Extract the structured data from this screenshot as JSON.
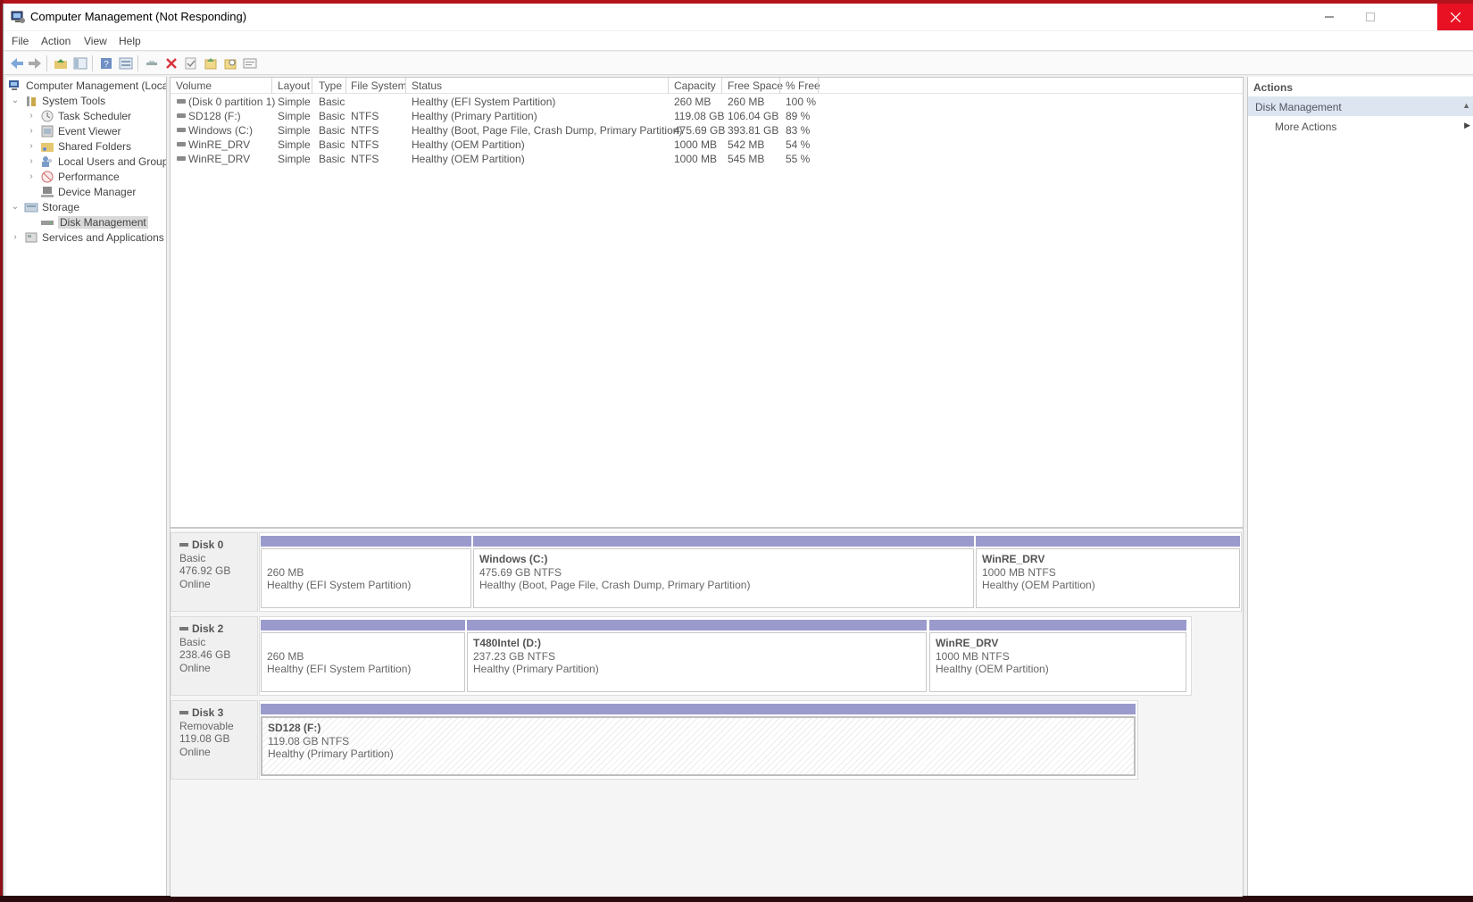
{
  "window": {
    "title": "Computer Management (Not Responding)"
  },
  "menu": [
    "File",
    "Action",
    "View",
    "Help"
  ],
  "toolbar": [
    "back-arrow-icon",
    "forward-arrow-icon",
    "up-folder-icon",
    "show-hide-tree-icon",
    "help-icon",
    "properties-icon",
    "connect-icon",
    "delete-icon",
    "check-icon",
    "export-icon",
    "search-icon",
    "list-icon"
  ],
  "tree": {
    "root": "Computer Management (Local",
    "system_tools": "System Tools",
    "task_scheduler": "Task Scheduler",
    "event_viewer": "Event Viewer",
    "shared_folders": "Shared Folders",
    "local_users": "Local Users and Groups",
    "performance": "Performance",
    "device_manager": "Device Manager",
    "storage": "Storage",
    "disk_management": "Disk Management",
    "services": "Services and Applications"
  },
  "volumes": {
    "headers": [
      "Volume",
      "Layout",
      "Type",
      "File System",
      "Status",
      "Capacity",
      "Free Space",
      "% Free"
    ],
    "rows": [
      [
        "(Disk 0 partition 1)",
        "Simple",
        "Basic",
        "",
        "Healthy (EFI System Partition)",
        "260 MB",
        "260 MB",
        "100 %"
      ],
      [
        "SD128 (F:)",
        "Simple",
        "Basic",
        "NTFS",
        "Healthy (Primary Partition)",
        "119.08 GB",
        "106.04 GB",
        "89 %"
      ],
      [
        "Windows (C:)",
        "Simple",
        "Basic",
        "NTFS",
        "Healthy (Boot, Page File, Crash Dump, Primary Partition)",
        "475.69 GB",
        "393.81 GB",
        "83 %"
      ],
      [
        "WinRE_DRV",
        "Simple",
        "Basic",
        "NTFS",
        "Healthy (OEM Partition)",
        "1000 MB",
        "542 MB",
        "54 %"
      ],
      [
        "WinRE_DRV",
        "Simple",
        "Basic",
        "NTFS",
        "Healthy (OEM Partition)",
        "1000 MB",
        "545 MB",
        "55 %"
      ]
    ]
  },
  "disks": [
    {
      "name": "Disk 0",
      "type": "Basic",
      "size": "476.92 GB",
      "state": "Online",
      "partitions": [
        {
          "name": "",
          "size": "260 MB",
          "status": "Healthy (EFI System Partition)"
        },
        {
          "name": "Windows  (C:)",
          "size": "475.69 GB NTFS",
          "status": "Healthy (Boot, Page File, Crash Dump, Primary Partition)"
        },
        {
          "name": "WinRE_DRV",
          "size": "1000 MB NTFS",
          "status": "Healthy (OEM Partition)"
        }
      ]
    },
    {
      "name": "Disk 2",
      "type": "Basic",
      "size": "238.46 GB",
      "state": "Online",
      "partitions": [
        {
          "name": "",
          "size": "260 MB",
          "status": "Healthy (EFI System Partition)"
        },
        {
          "name": "T480Intel  (D:)",
          "size": "237.23 GB NTFS",
          "status": "Healthy (Primary Partition)"
        },
        {
          "name": "WinRE_DRV",
          "size": "1000 MB NTFS",
          "status": "Healthy (OEM Partition)"
        }
      ]
    },
    {
      "name": "Disk 3",
      "type": "Removable",
      "size": "119.08 GB",
      "state": "Online",
      "partitions": [
        {
          "name": "SD128  (F:)",
          "size": "119.08 GB NTFS",
          "status": "Healthy (Primary Partition)"
        }
      ]
    }
  ],
  "actions": {
    "header": "Actions",
    "section": "Disk Management",
    "more": "More Actions"
  }
}
